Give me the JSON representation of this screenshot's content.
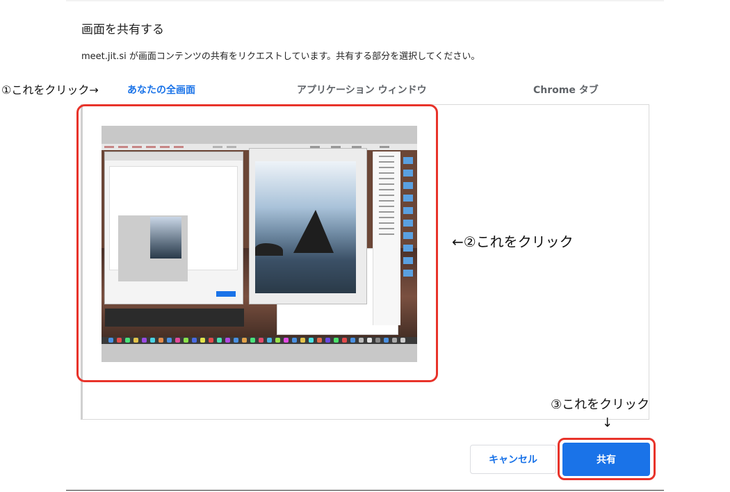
{
  "dialog": {
    "title": "画面を共有する",
    "description": "meet.jit.si が画面コンテンツの共有をリクエストしています。共有する部分を選択してください。"
  },
  "tabs": [
    {
      "label": "あなたの全画面",
      "active": true
    },
    {
      "label": "アプリケーション ウィンドウ",
      "active": false
    },
    {
      "label": "Chrome タブ",
      "active": false
    }
  ],
  "annotations": {
    "step1": "①これをクリック→",
    "step2": "←②これをクリック",
    "step3": "③これをクリック",
    "step3_arrow": "↓"
  },
  "buttons": {
    "cancel": "キャンセル",
    "share": "共有"
  },
  "colors": {
    "accent": "#1a73e8",
    "highlight": "#e8332a"
  },
  "screen_preview": {
    "icon": "screen-thumbnail"
  }
}
